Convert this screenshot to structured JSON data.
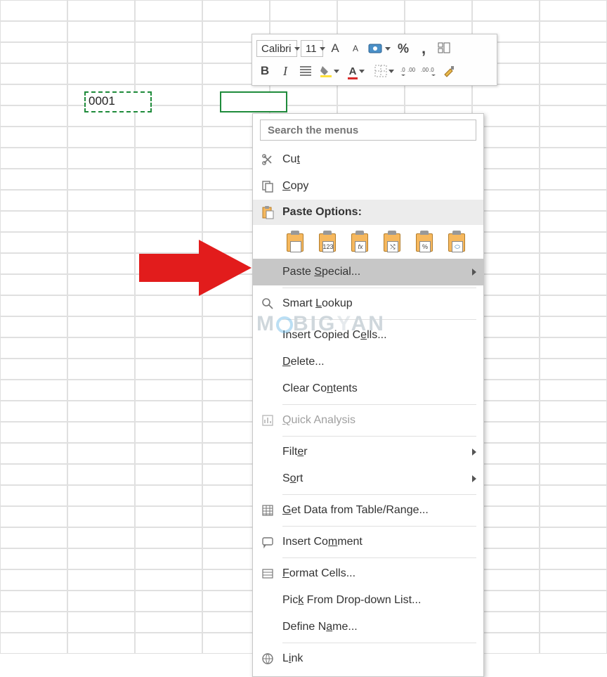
{
  "cell_value": "0001",
  "toolbar": {
    "font": "Calibri",
    "size": "11",
    "increase_font": "A",
    "decrease_font": "A",
    "percent": "%",
    "comma": ",",
    "bold": "B",
    "italic": "I"
  },
  "menu": {
    "search_placeholder": "Search the menus",
    "cut": "Cut",
    "copy": "Copy",
    "paste_options": "Paste Options:",
    "paste_special": "Paste Special...",
    "smart_lookup": "Smart Lookup",
    "insert_copied": "Insert Copied Cells...",
    "delete": "Delete...",
    "clear_contents": "Clear Contents",
    "quick_analysis": "Quick Analysis",
    "filter": "Filter",
    "sort": "Sort",
    "get_data": "Get Data from Table/Range...",
    "insert_comment": "Insert Comment",
    "format_cells": "Format Cells...",
    "pick_list": "Pick From Drop-down List...",
    "define_name": "Define Name...",
    "link": "Link"
  },
  "paste_labels": [
    "",
    "123",
    "fx",
    "",
    "%",
    "∞"
  ],
  "watermark": "M BIG AN"
}
